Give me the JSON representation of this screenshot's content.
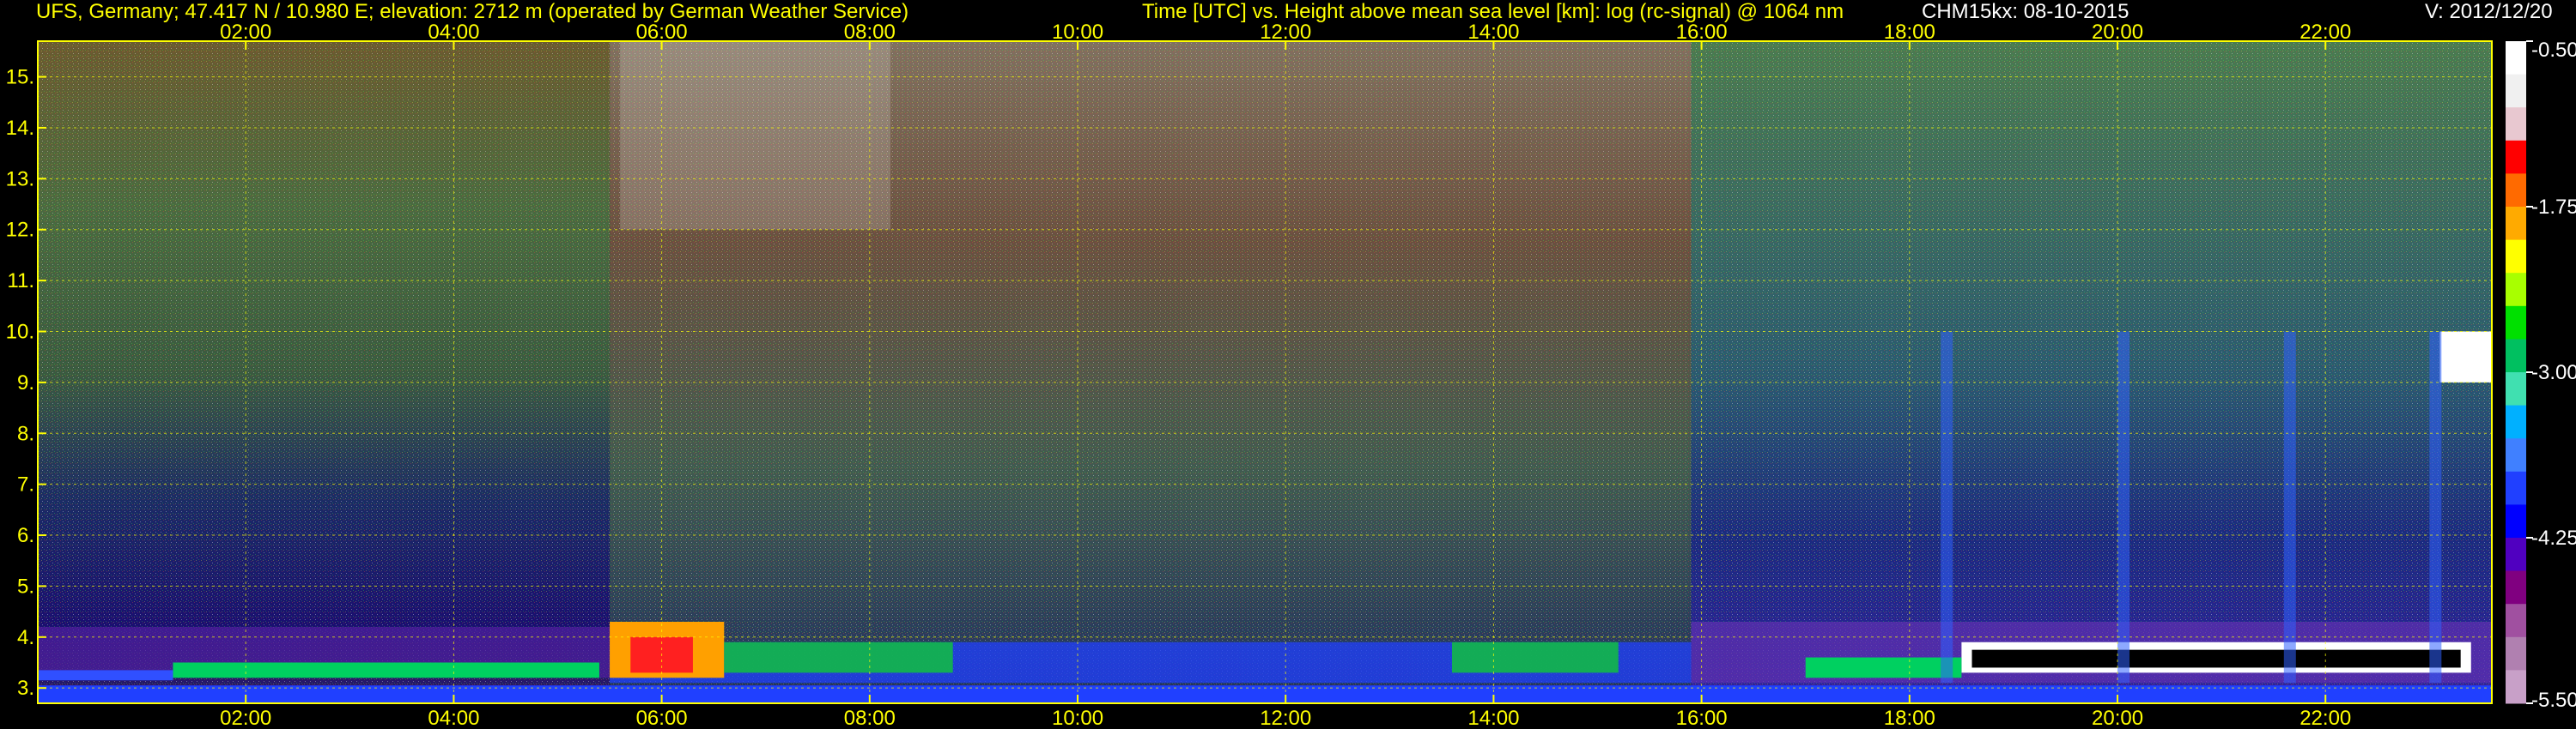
{
  "header": {
    "station": "UFS, Germany; 47.417 N / 10.980 E; elevation: 2712 m  (operated by German Weather Service)",
    "axes_title": "Time [UTC] vs. Height above mean sea level [km]: log (rc-signal) @ 1064 nm",
    "instrument_date": "CHM15kx: 08-10-2015",
    "version": "V: 2012/12/20"
  },
  "colors": {
    "text_primary": "#ffff00",
    "text_secondary": "#ffffff",
    "grid": "#ffff00",
    "frame": "#ffff00",
    "background": "#000000"
  },
  "chart_data": {
    "type": "heatmap",
    "title": "Time [UTC] vs. Height above mean sea level [km]: log (rc-signal) @ 1064 nm",
    "xlabel": "Time [UTC]",
    "ylabel": "Height above mean sea level [km]",
    "x_range_hours": [
      0.0,
      23.6
    ],
    "ylim": [
      2.7,
      15.7
    ],
    "x_ticks": [
      "02:00",
      "04:00",
      "06:00",
      "08:00",
      "10:00",
      "12:00",
      "14:00",
      "16:00",
      "18:00",
      "20:00",
      "22:00"
    ],
    "x_tick_hours": [
      2,
      4,
      6,
      8,
      10,
      12,
      14,
      16,
      18,
      20,
      22
    ],
    "y_ticks": [
      3,
      4,
      5,
      6,
      7,
      8,
      9,
      10,
      11,
      12,
      13,
      14,
      15
    ],
    "y_tick_labels": [
      "3.",
      "4.",
      "5.",
      "6.",
      "7.",
      "8.",
      "9.",
      "10.",
      "11.",
      "12.",
      "13.",
      "14.",
      "15."
    ],
    "grid": true,
    "colorbar": {
      "min": -5.5,
      "max": -0.5,
      "ticks": [
        -0.5,
        -1.75,
        -3.0,
        -4.25,
        -5.5
      ],
      "tick_labels": [
        "-0.50",
        "-1.75",
        "-3.00",
        "-4.25",
        "-5.50"
      ],
      "colors": [
        "#ffffff",
        "#f0f0f0",
        "#e8c8d0",
        "#ff0000",
        "#ff6a00",
        "#ffaa00",
        "#ffff00",
        "#a8ff00",
        "#00e000",
        "#00c060",
        "#40e0b0",
        "#00b0ff",
        "#4080ff",
        "#2040ff",
        "#0000ff",
        "#5000c0",
        "#800080",
        "#a050a0",
        "#b080b0",
        "#c8a0c8"
      ]
    },
    "annotations": {
      "boundary_layer_top_km": 4.0,
      "cloud_layer_evening_km": [
        3.3,
        3.9
      ],
      "cloud_patch_late_km": [
        9.0,
        10.0
      ]
    }
  }
}
